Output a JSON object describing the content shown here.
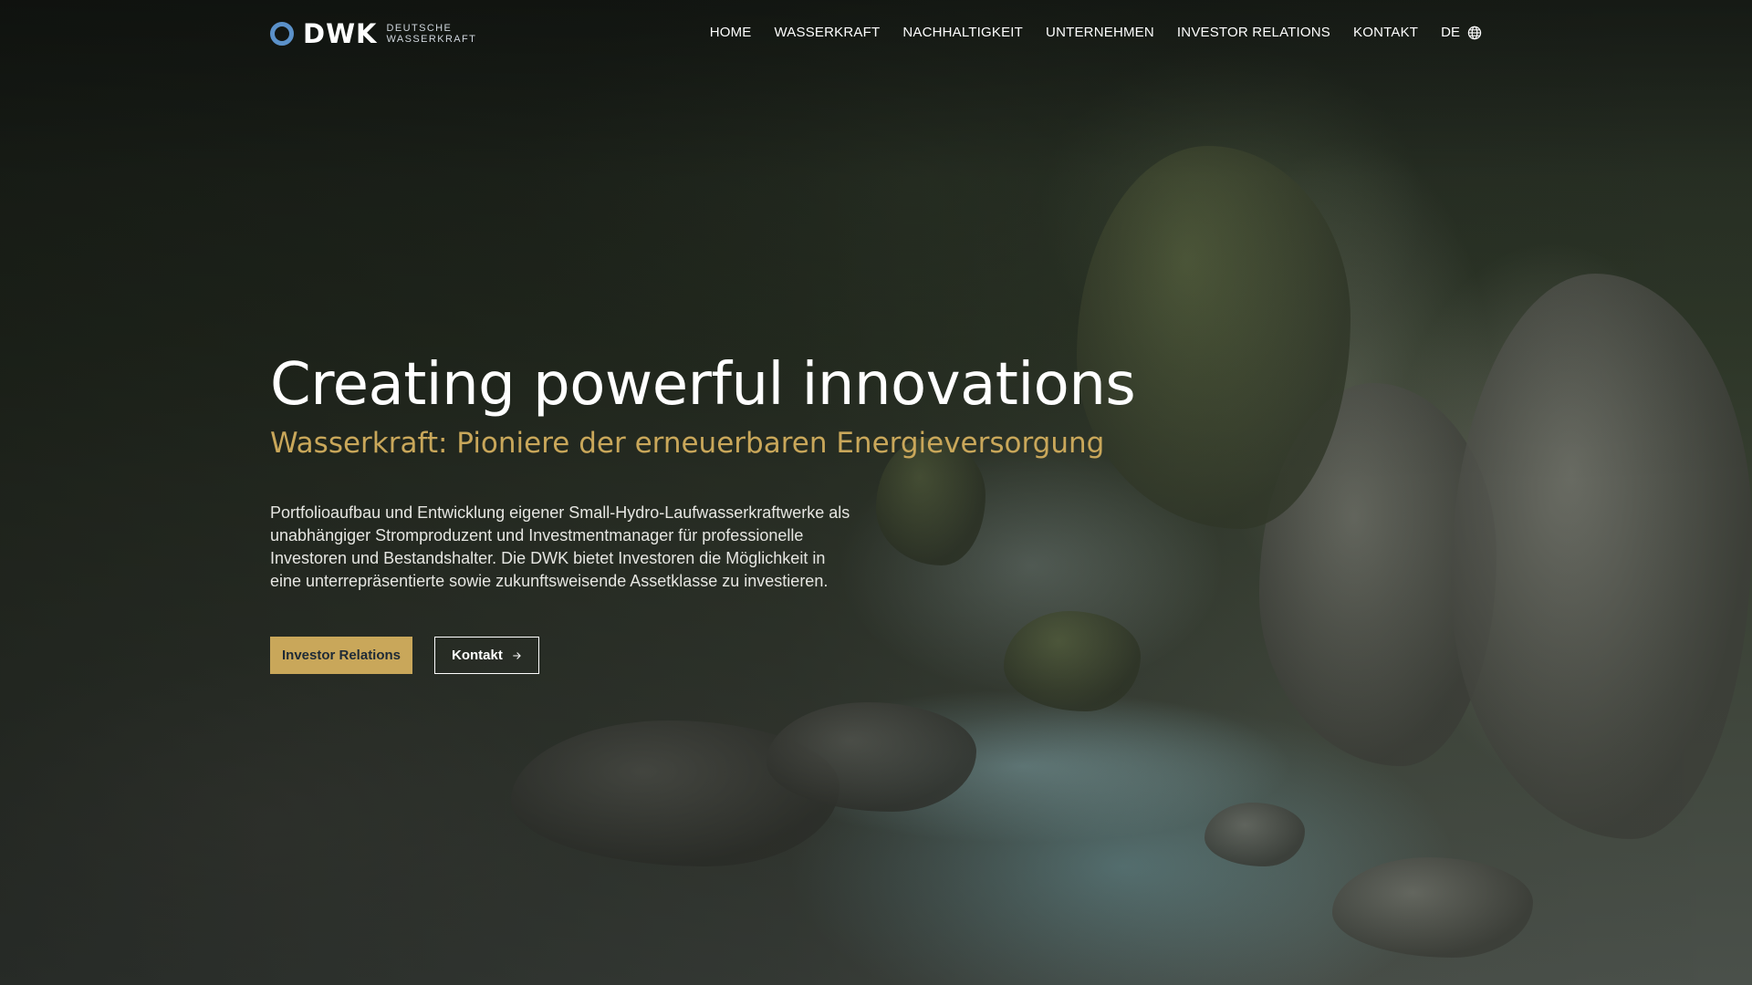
{
  "brand": {
    "logo_word": "DWK",
    "logo_sub_line1": "DEUTSCHE",
    "logo_sub_line2": "WASSERKRAFT",
    "accent_color": "#c9a75a",
    "logo_ring_color": "#5b91c9"
  },
  "nav": {
    "items": [
      {
        "label": "HOME"
      },
      {
        "label": "WASSERKRAFT"
      },
      {
        "label": "NACHHALTIGKEIT"
      },
      {
        "label": "UNTERNEHMEN"
      },
      {
        "label": "INVESTOR RELATIONS"
      },
      {
        "label": "KONTAKT"
      }
    ],
    "language": "DE",
    "language_icon": "globe-icon"
  },
  "hero": {
    "title": "Creating powerful innovations",
    "subtitle": "Wasserkraft: Pioniere der erneuerbaren Energieversorgung",
    "text": "Portfolioaufbau und Entwicklung eigener Small-Hydro-Laufwasserkraftwerke als unabhängiger Stromproduzent und Investmentmanager für professionelle Investoren und Bestandshalter. Die DWK bietet Investoren die Möglichkeit in eine unterrepräsentierte sowie zukunftsweisende Assetklasse zu investieren.",
    "buttons": {
      "primary_label": "Investor Relations",
      "secondary_label": "Kontakt",
      "secondary_icon": "arrow-right-icon"
    }
  }
}
